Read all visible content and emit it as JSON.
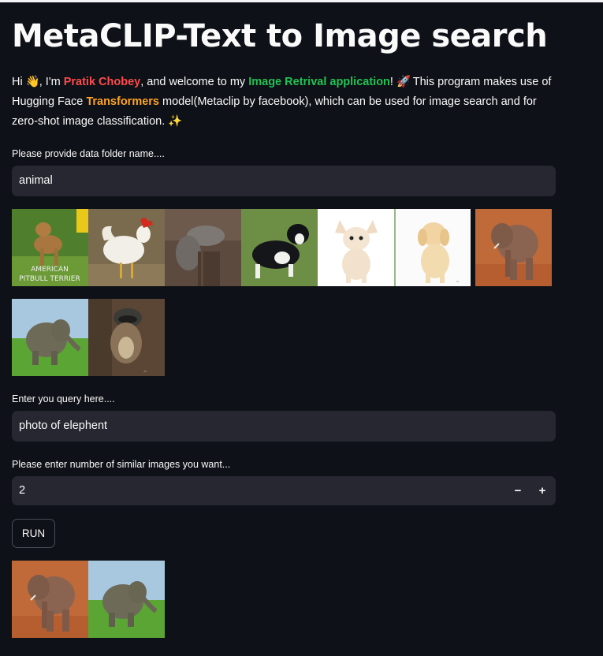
{
  "title": "MetaCLIP-Text to Image search",
  "intro": {
    "hi": "Hi",
    "wave_emoji": "👋",
    "im": ", I'm",
    "name": "Pratik Chobey",
    "welcome": ", and welcome to my",
    "app": "Image Retrival application",
    "bang": "!",
    "rocket_emoji": "🚀",
    "desc1": " This program makes use of Hugging Face",
    "transformers": "Transformers",
    "desc2": "model(Metaclip by facebook), which can be used for image search and for zero-shot image classification.",
    "sparkle_emoji": "✨"
  },
  "folder": {
    "label": "Please provide data folder name....",
    "value": "animal"
  },
  "gallery_images": [
    {
      "name": "image-pitbull",
      "caption": "AMERICAN PITBULL TERRIER"
    },
    {
      "name": "image-rooster"
    },
    {
      "name": "image-squirrel"
    },
    {
      "name": "image-border-collie"
    },
    {
      "name": "image-chihuahua"
    },
    {
      "name": "image-golden-puppy"
    },
    {
      "name": "image-elephant-adult"
    },
    {
      "name": "image-elephant-calf"
    },
    {
      "name": "image-squirrel-tree"
    }
  ],
  "query": {
    "label": "Enter you query here....",
    "value": "photo of elephent"
  },
  "count": {
    "label": "Please enter number of similar images you want...",
    "value": "2",
    "minus": "−",
    "plus": "+"
  },
  "run_label": "RUN",
  "results": [
    {
      "name": "result-elephant-adult"
    },
    {
      "name": "result-elephant-calf"
    }
  ]
}
